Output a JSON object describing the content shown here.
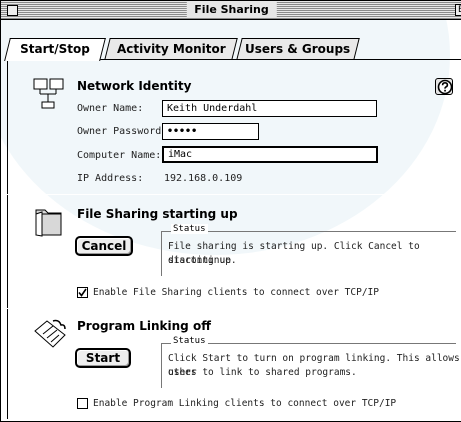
{
  "window": {
    "title": "File Sharing",
    "zoom_glyph": "E"
  },
  "tabs": [
    {
      "label": "Start/Stop",
      "active": true
    },
    {
      "label": "Activity Monitor",
      "active": false
    },
    {
      "label": "Users & Groups",
      "active": false
    }
  ],
  "identity": {
    "title": "Network Identity",
    "icon": "network-identity-icon",
    "owner_name_label": "Owner Name:",
    "owner_name_value": "Keith Underdahl",
    "owner_password_label": "Owner Password:",
    "owner_password_value": "•••••",
    "computer_name_label": "Computer Name:",
    "computer_name_value": "iMac",
    "ip_label": "IP Address:",
    "ip_value": "192.168.0.109"
  },
  "file_sharing": {
    "title": "File Sharing starting up",
    "icon": "shared-folder-icon",
    "button_label": "Cancel",
    "status_label": "Status",
    "status_line1": "File sharing is starting up. Click Cancel to discontinue",
    "status_line2": "starting up.",
    "checkbox_label": "Enable File Sharing clients to connect over TCP/IP",
    "checkbox_checked": true
  },
  "program_linking": {
    "title": "Program Linking off",
    "icon": "program-linking-icon",
    "button_label": "Start",
    "status_label": "Status",
    "status_line1": "Click Start to turn on program linking. This allows other",
    "status_line2": "users to link to shared programs.",
    "checkbox_label": "Enable Program Linking clients to connect over TCP/IP",
    "checkbox_checked": false
  },
  "help_icon": "help-question-icon"
}
